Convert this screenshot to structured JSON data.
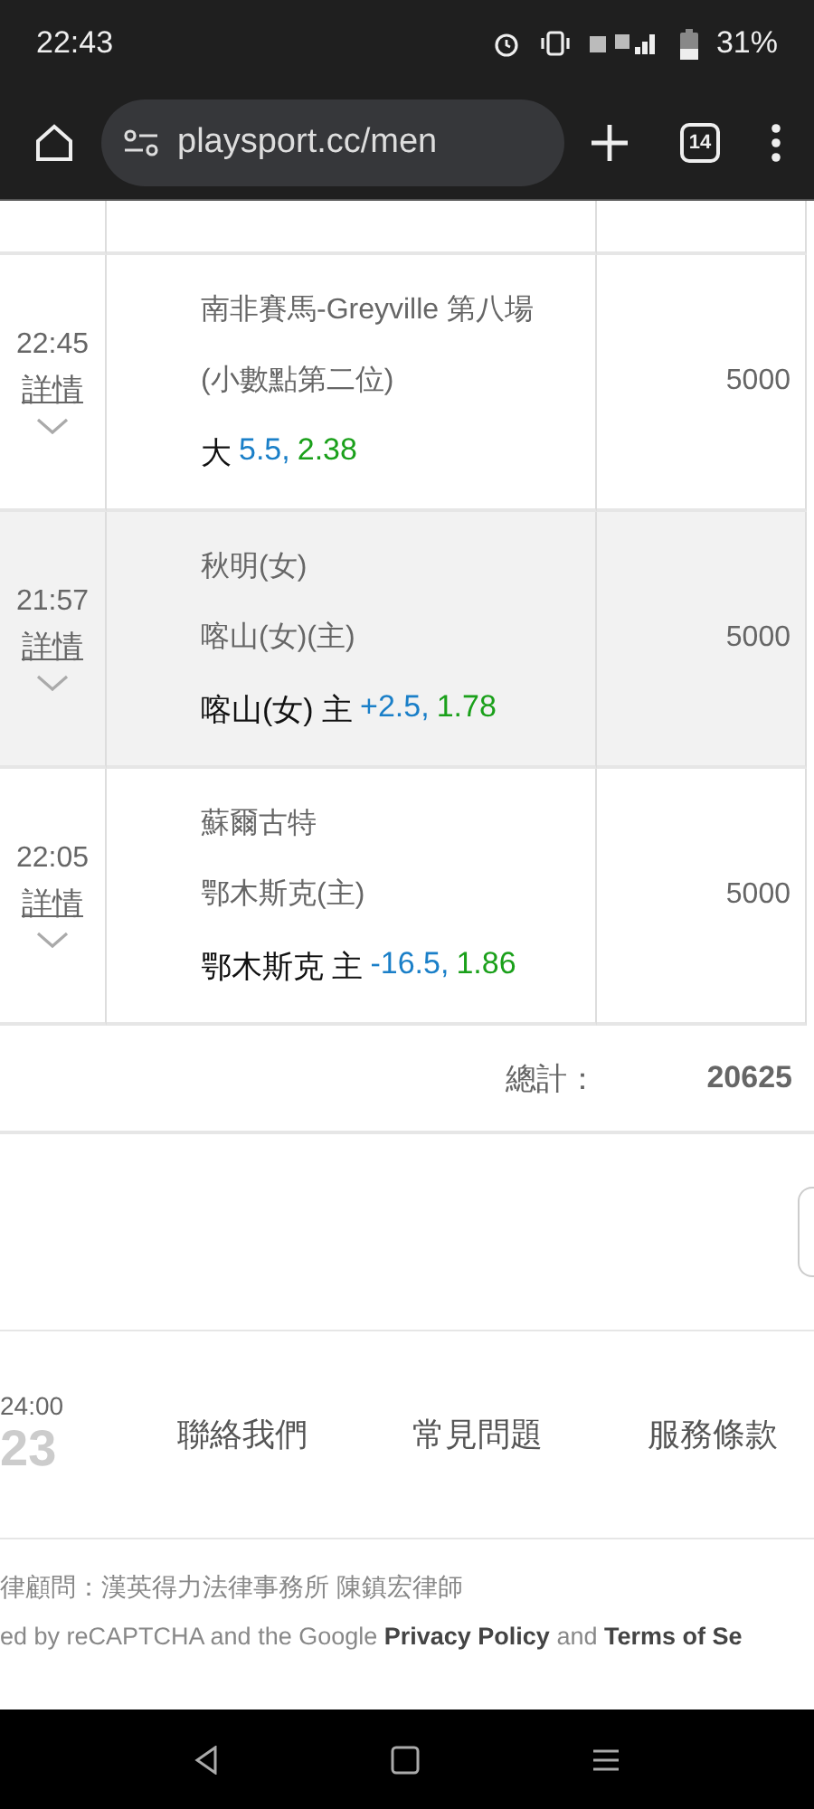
{
  "status_bar": {
    "time": "22:43",
    "battery": "31%"
  },
  "browser": {
    "url": "playsport.cc/men",
    "tab_count": "14"
  },
  "rows": [
    {
      "time": "22:45",
      "details": "詳情",
      "lines": [
        "南非賽馬-Greyville 第八場",
        "(小數點第二位)"
      ],
      "pick": {
        "team": "大",
        "line": "5.5,",
        "odds": "2.38"
      },
      "amount": "5000",
      "highlighted": false
    },
    {
      "time": "21:57",
      "details": "詳情",
      "lines": [
        "秋明(女)",
        "喀山(女)(主)"
      ],
      "pick": {
        "team": "喀山(女) 主",
        "line": "+2.5,",
        "odds": "1.78"
      },
      "amount": "5000",
      "highlighted": true
    },
    {
      "time": "22:05",
      "details": "詳情",
      "lines": [
        "蘇爾古特",
        "鄂木斯克(主)"
      ],
      "pick": {
        "team": "鄂木斯克 主",
        "line": "-16.5,",
        "odds": "1.86"
      },
      "amount": "5000",
      "highlighted": false
    }
  ],
  "total": {
    "label": "總計：",
    "value": "20625"
  },
  "footer": {
    "hours": "24:00",
    "phone": "23",
    "links": [
      "聯絡我們",
      "常見問題",
      "服務條款"
    ],
    "legal": "律顧問：漢英得力法律事務所 陳鎮宏律師",
    "recaptcha": "ed by reCAPTCHA and the Google **Privacy Policy** and **Terms of Se**"
  }
}
